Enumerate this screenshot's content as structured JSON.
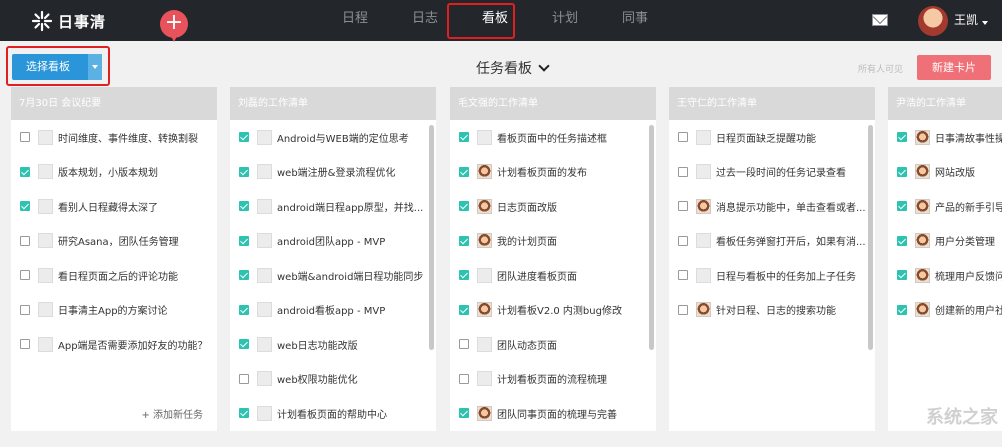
{
  "app": {
    "name": "日事清",
    "add_label": "+"
  },
  "nav": {
    "items": [
      "日程",
      "日志",
      "看板",
      "计划",
      "同事"
    ],
    "active_index": 2
  },
  "user": {
    "name": "王凯"
  },
  "toolbar": {
    "select_board_label": "选择看板",
    "board_title": "任务看板",
    "visibility": "所有人可见",
    "new_card_label": "新建卡片"
  },
  "columns": [
    {
      "title": "7月30日 会议纪要",
      "add_task_label": "+ 添加新任务",
      "tasks": [
        {
          "text": "时间维度、事件维度、转换割裂",
          "checked": false
        },
        {
          "text": "版本规划，小版本规划",
          "checked": true
        },
        {
          "text": "看别人日程藏得太深了",
          "checked": true
        },
        {
          "text": "研究Asana，团队任务管理",
          "checked": false
        },
        {
          "text": "看日程页面之后的评论功能",
          "checked": false
        },
        {
          "text": "日事清主App的方案讨论",
          "checked": false
        },
        {
          "text": "App端是否需要添加好友的功能？",
          "checked": false
        }
      ]
    },
    {
      "title": "刘磊的工作清单",
      "tasks": [
        {
          "text": "Android与WEB端的定位思考",
          "checked": true
        },
        {
          "text": "web端注册&登录流程优化",
          "checked": true
        },
        {
          "text": "android端日程app原型，并找...",
          "checked": true
        },
        {
          "text": "android团队app - MVP",
          "checked": true
        },
        {
          "text": "web端&android端日程功能同步",
          "checked": true
        },
        {
          "text": "android看板app - MVP",
          "checked": true
        },
        {
          "text": "web日志功能改版",
          "checked": true
        },
        {
          "text": "web权限功能优化",
          "checked": false
        },
        {
          "text": "计划看板页面的帮助中心",
          "checked": true
        }
      ]
    },
    {
      "title": "毛文强的工作清单",
      "tasks": [
        {
          "text": "看板页面中的任务描述框",
          "checked": true,
          "pic": false
        },
        {
          "text": "计划看板页面的发布",
          "checked": true,
          "pic": true
        },
        {
          "text": "日志页面改版",
          "checked": true,
          "pic": true
        },
        {
          "text": "我的计划页面",
          "checked": true,
          "pic": true
        },
        {
          "text": "团队进度看板页面",
          "checked": true,
          "pic": false
        },
        {
          "text": "计划看板V2.0 内测bug修改",
          "checked": true,
          "pic": true
        },
        {
          "text": "团队动态页面",
          "checked": false,
          "pic": false
        },
        {
          "text": "计划看板页面的流程梳理",
          "checked": false,
          "pic": false
        },
        {
          "text": "团队同事页面的梳理与完善",
          "checked": true,
          "pic": true
        }
      ]
    },
    {
      "title": "王守仁的工作清单",
      "tasks": [
        {
          "text": "日程页面缺乏提醒功能",
          "checked": false,
          "pic": false
        },
        {
          "text": "过去一段时间的任务记录查看",
          "checked": false,
          "pic": false
        },
        {
          "text": "消息提示功能中，单击查看或者...",
          "checked": false,
          "pic": true
        },
        {
          "text": "看板任务弹窗打开后，如果有消...",
          "checked": false,
          "pic": false
        },
        {
          "text": "日程与看板中的任务加上子任务",
          "checked": false,
          "pic": false
        },
        {
          "text": "针对日程、日志的搜索功能",
          "checked": false,
          "pic": true
        }
      ]
    },
    {
      "title": "尹浩的工作清单",
      "tasks": [
        {
          "text": "日事清故事性操",
          "checked": true,
          "pic": true
        },
        {
          "text": "网站改版",
          "checked": true,
          "pic": true
        },
        {
          "text": "产品的新手引导",
          "checked": true,
          "pic": true
        },
        {
          "text": "用户分类管理",
          "checked": true,
          "pic": true
        },
        {
          "text": "梳理用户反馈问",
          "checked": true,
          "pic": true
        },
        {
          "text": "创建新的用户社",
          "checked": true,
          "pic": true
        }
      ]
    }
  ],
  "watermark": "系统之家"
}
